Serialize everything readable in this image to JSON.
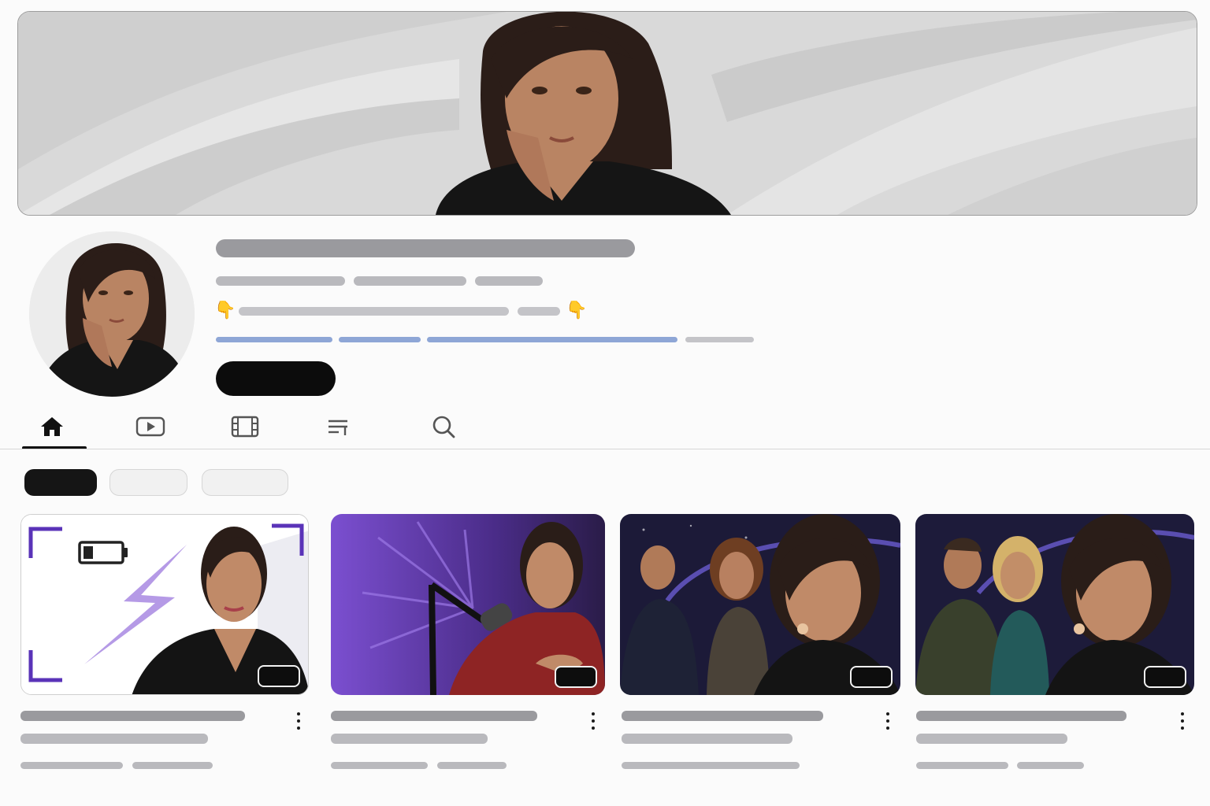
{
  "channel": {
    "name": "",
    "handle": "",
    "subscribers": "",
    "video_count": "",
    "description": "",
    "link": "",
    "subscribe_label": "",
    "description_emoji": "👇"
  },
  "tabs": [
    {
      "icon": "home-icon",
      "label": ""
    },
    {
      "icon": "videos-icon",
      "label": ""
    },
    {
      "icon": "shorts-film-icon",
      "label": ""
    },
    {
      "icon": "playlists-icon",
      "label": ""
    },
    {
      "icon": "search-icon",
      "label": ""
    }
  ],
  "active_tab": 0,
  "chips": [
    {
      "label": "",
      "selected": true
    },
    {
      "label": "",
      "selected": false
    },
    {
      "label": "",
      "selected": false
    }
  ],
  "videos": [
    {
      "title": "",
      "views": "",
      "age": "",
      "duration": "",
      "thumbnail": "woman-blazer-low-battery-lightning"
    },
    {
      "title": "",
      "views": "",
      "age": "",
      "duration": "",
      "thumbnail": "woman-podcast-microphone-purple"
    },
    {
      "title": "",
      "views": "",
      "age": "",
      "duration": "",
      "thumbnail": "woman-with-group-night-sky"
    },
    {
      "title": "",
      "views": "",
      "age": "",
      "duration": "",
      "thumbnail": "woman-with-group-night-sky-2"
    }
  ],
  "colors": {
    "accent_purple": "#7b4fd0",
    "link_blue": "#8ea6d6",
    "button_dark": "#0c0c0c"
  }
}
